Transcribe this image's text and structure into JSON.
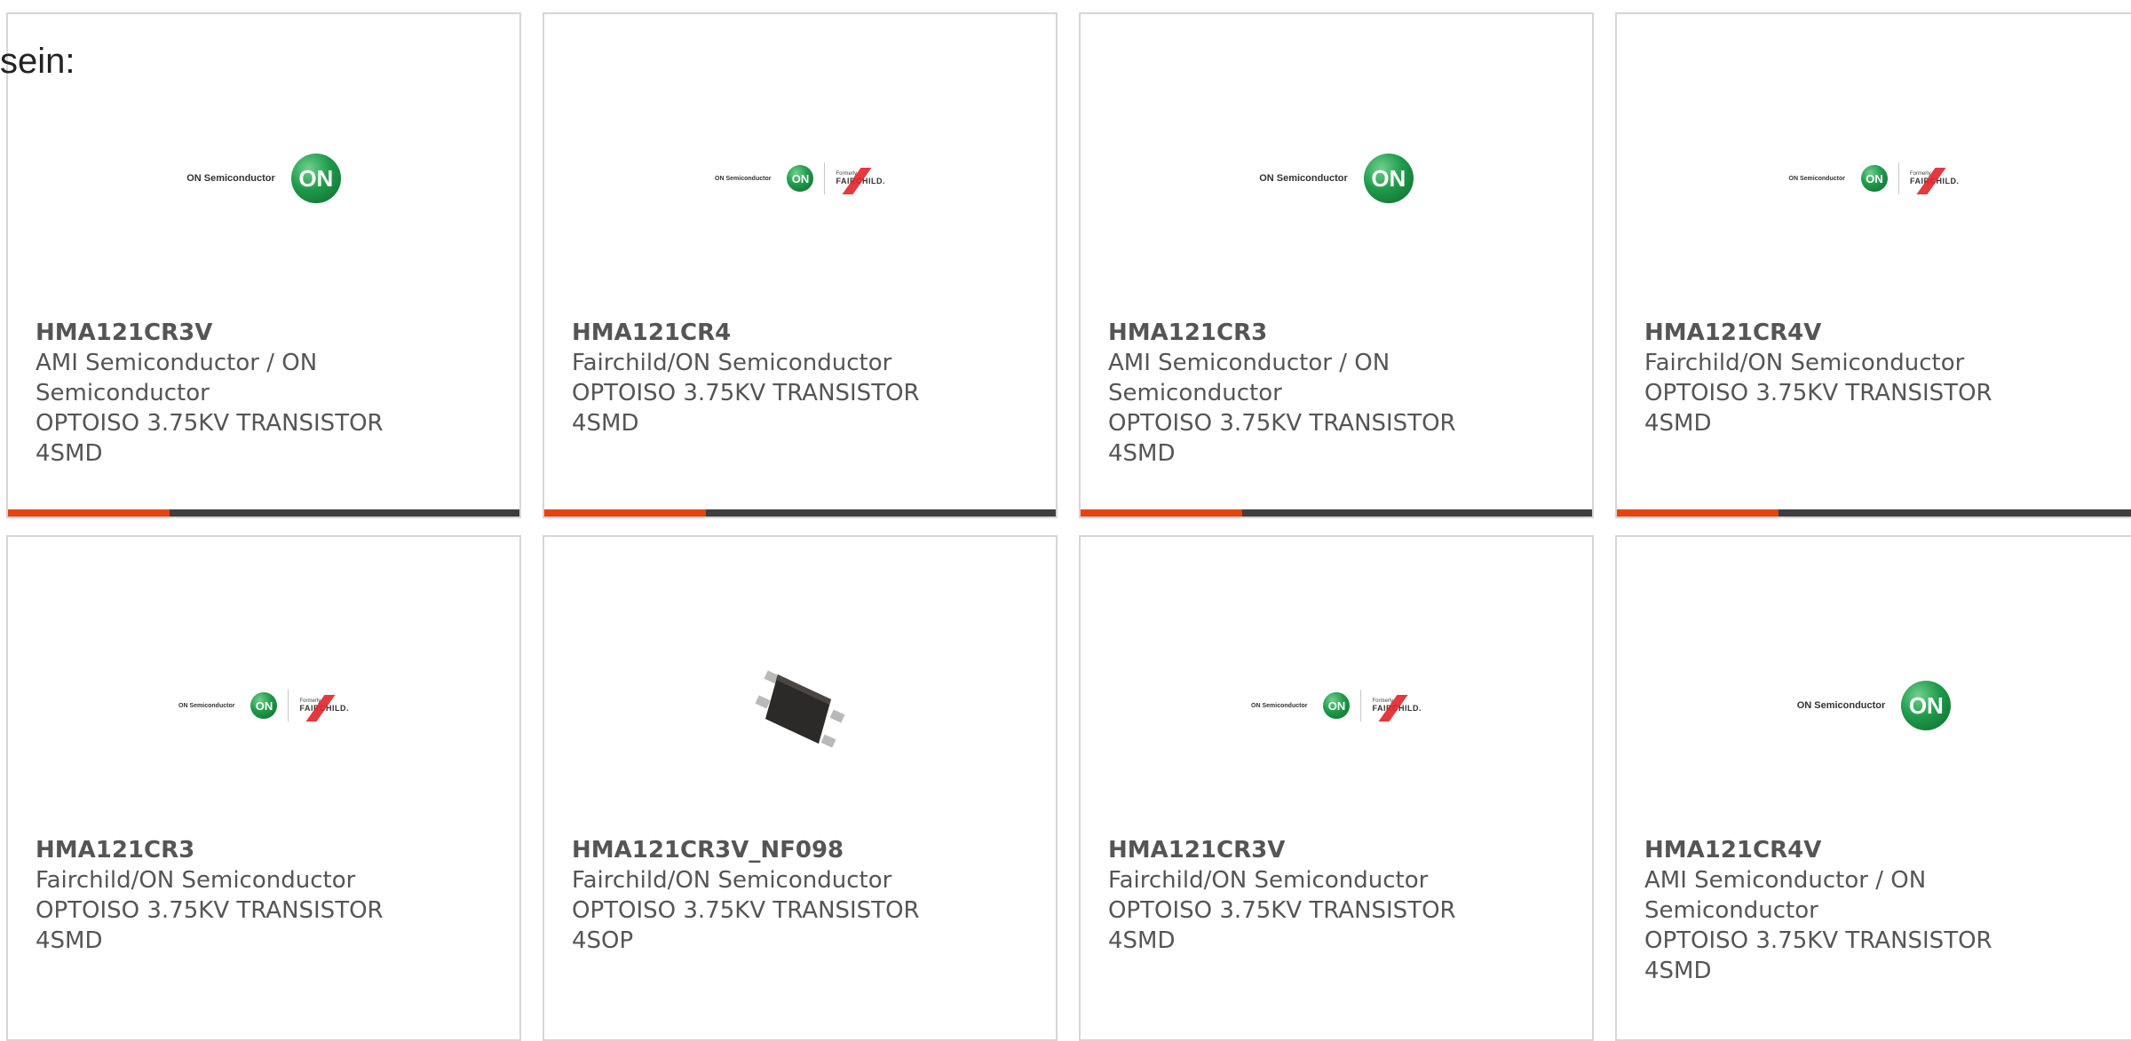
{
  "intro_text": "sein:",
  "colors": {
    "accent_red": "#e64312",
    "bar_dark": "#3e3e3e",
    "on_green": "#1f9a4a",
    "fairchild_red": "#e2222a",
    "card_border": "#d6d6d6",
    "text": "#555555"
  },
  "products": [
    {
      "name": "HMA121CR3V",
      "manufacturer": "AMI Semiconductor / ON Semiconductor",
      "description": "OPTOISO 3.75KV TRANSISTOR 4SMD",
      "image": "on-semiconductor-logo",
      "logo_text": "ON Semiconductor",
      "logo_mark": "ON"
    },
    {
      "name": "HMA121CR4",
      "manufacturer": "Fairchild/ON Semiconductor",
      "description": "OPTOISO 3.75KV TRANSISTOR 4SMD",
      "image": "on-fairchild-logo",
      "logo_text": "ON Semiconductor",
      "logo_mark": "ON",
      "formerly": "Formerly",
      "fairchild": "FAIRCHILD."
    },
    {
      "name": "HMA121CR3",
      "manufacturer": "AMI Semiconductor / ON Semiconductor",
      "description": "OPTOISO 3.75KV TRANSISTOR 4SMD",
      "image": "on-semiconductor-logo",
      "logo_text": "ON Semiconductor",
      "logo_mark": "ON"
    },
    {
      "name": "HMA121CR4V",
      "manufacturer": "Fairchild/ON Semiconductor",
      "description": "OPTOISO 3.75KV TRANSISTOR 4SMD",
      "image": "on-fairchild-logo",
      "logo_text": "ON Semiconductor",
      "logo_mark": "ON",
      "formerly": "Formerly",
      "fairchild": "FAIRCHILD."
    },
    {
      "name": "HMA121CR3",
      "manufacturer": "Fairchild/ON Semiconductor",
      "description": "OPTOISO 3.75KV TRANSISTOR 4SMD",
      "image": "on-fairchild-logo",
      "logo_text": "ON Semiconductor",
      "logo_mark": "ON",
      "formerly": "Formerly",
      "fairchild": "FAIRCHILD."
    },
    {
      "name": "HMA121CR3V_NF098",
      "manufacturer": "Fairchild/ON Semiconductor",
      "description": "OPTOISO 3.75KV TRANSISTOR 4SOP",
      "image": "4sop-chip-photo"
    },
    {
      "name": "HMA121CR3V",
      "manufacturer": "Fairchild/ON Semiconductor",
      "description": "OPTOISO 3.75KV TRANSISTOR 4SMD",
      "image": "on-fairchild-logo",
      "logo_text": "ON Semiconductor",
      "logo_mark": "ON",
      "formerly": "Formerly",
      "fairchild": "FAIRCHILD."
    },
    {
      "name": "HMA121CR4V",
      "manufacturer": "AMI Semiconductor / ON Semiconductor",
      "description": "OPTOISO 3.75KV TRANSISTOR 4SMD",
      "image": "on-semiconductor-logo",
      "logo_text": "ON Semiconductor",
      "logo_mark": "ON"
    }
  ]
}
